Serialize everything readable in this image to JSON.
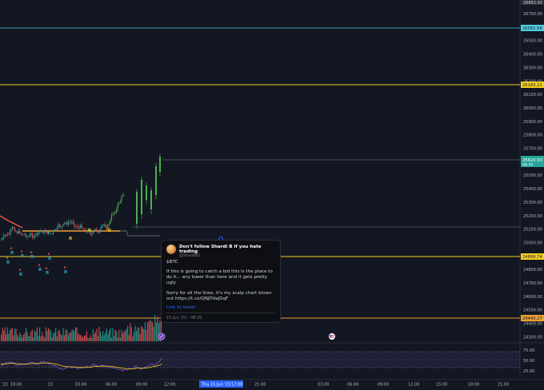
{
  "price_axis": {
    "top_label": "26892.93",
    "ticks": [
      "26700.00",
      "26600.00",
      "26500.00",
      "26400.00",
      "26300.00",
      "26200.00",
      "26100.00",
      "26000.00",
      "25900.00",
      "25800.00",
      "25700.00",
      "25600.00",
      "25500.00",
      "25400.00",
      "25300.00",
      "25200.00",
      "25100.00",
      "25000.00",
      "24900.00",
      "24800.00",
      "24700.00",
      "24600.00",
      "24500.00",
      "24400.00",
      "24300.00"
    ],
    "ticks_visible": true
  },
  "price_labels": {
    "cyan_level": "26582.56",
    "yellow_level_top": "26183.21",
    "current_price": "25620.93",
    "countdown": "06:34",
    "yellow_level_mid": "24899.74",
    "orange_level": "24445.27"
  },
  "indicator_axis": {
    "ticks": [
      "75.00",
      "50.00",
      "25.00"
    ]
  },
  "time_axis": {
    "labels": [
      "'23",
      "19:00",
      "15",
      "03:00",
      "06:00",
      "09:00",
      "12:00",
      "18:00",
      "21:00",
      "03:00",
      "06:00",
      "09:00",
      "12:00",
      "15:00",
      "18:00",
      "21:00"
    ],
    "highlight_label": "Thu 15 Jun '23",
    "highlight_time": "17:00"
  },
  "signal_markers": {
    "buy_labels": [
      "R",
      "R",
      "R",
      "R",
      "R",
      "R",
      "R",
      "R",
      "R"
    ],
    "marker_colors": {
      "buy": "#2aa4c9",
      "sell": "#e8c21b"
    }
  },
  "tweet": {
    "author": "Don't follow Shardi B if you hate trading",
    "handle": "@ShardiB2",
    "ticker": "$BTC",
    "paragraph_1": "If this is going to catch a bid this is the place to do it... any lower than here and it gets pretty ugly",
    "paragraph_2": "Sorry for all the lines, it's my scalp chart blown out https://t.co/QNJDVaJGqF",
    "link_text": "Link to tweet",
    "date": "15 Jun '23 - 08:20"
  },
  "colors": {
    "background": "#131722",
    "up": "#26a69a",
    "up_bright": "#4caf50",
    "down": "#ef5350",
    "cyan_line": "#4dd0e1",
    "yellow_line": "#f5d020",
    "orange_line": "#f0a030",
    "rsi": "#7e57c2"
  }
}
